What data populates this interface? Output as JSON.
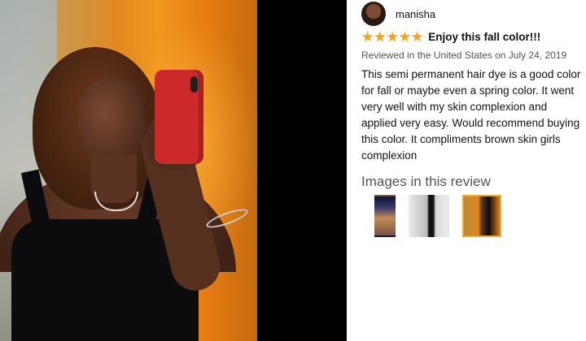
{
  "review": {
    "author_name": "manisha",
    "rating": 5,
    "stars": [
      "★",
      "★",
      "★",
      "★",
      "★"
    ],
    "title": "Enjoy this fall color!!!",
    "meta": "Reviewed in the United States on July 24, 2019",
    "body": "This semi permanent hair dye is a good color for fall or maybe even a spring color. It went very well with my skin complexion and applied very easy. Would recommend buying this color. It compliments brown skin girls complexion",
    "images_heading": "Images in this review",
    "selected_thumbnail": 3
  },
  "colors": {
    "star": "#f4a416",
    "selected_border": "#f0a826"
  },
  "icons": {
    "star": "star-icon"
  }
}
